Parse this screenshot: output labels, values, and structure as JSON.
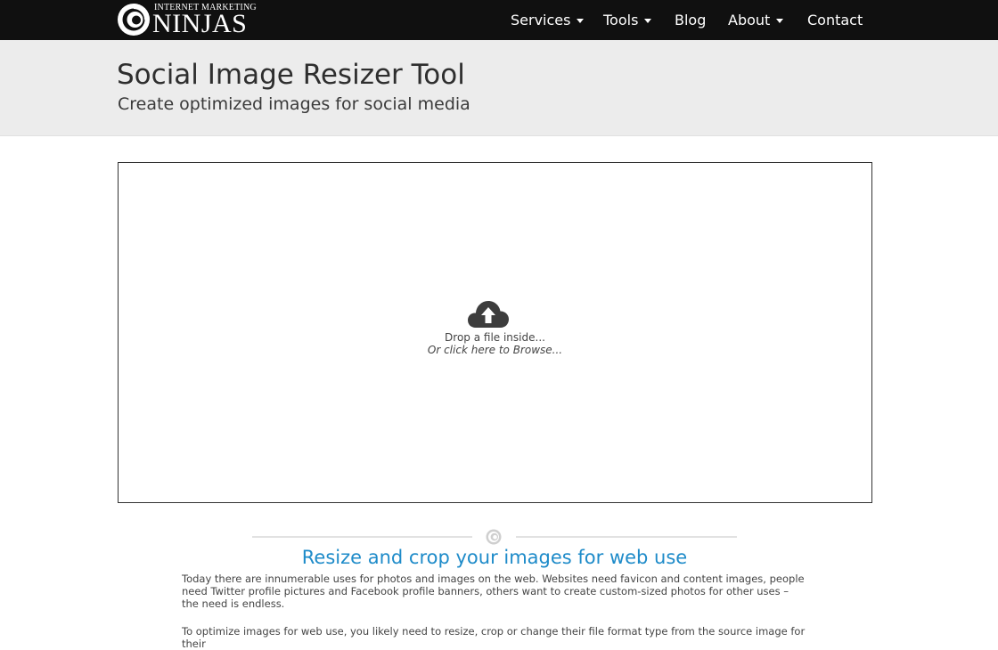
{
  "brand": {
    "small_text": "INTERNET MARKETING",
    "big_text": "NINJAS"
  },
  "nav": {
    "items": [
      {
        "label": "Services",
        "dropdown": true
      },
      {
        "label": "Tools",
        "dropdown": true
      },
      {
        "label": "Blog",
        "dropdown": false
      },
      {
        "label": "About",
        "dropdown": true
      },
      {
        "label": "Contact",
        "dropdown": false
      }
    ]
  },
  "hero": {
    "title": "Social Image Resizer Tool",
    "subtitle": "Create optimized images for social media"
  },
  "dropzone": {
    "icon": "cloud-upload-icon",
    "line1": "Drop a file inside...",
    "line2": "Or click here to Browse..."
  },
  "section": {
    "heading": "Resize and crop your images for web use",
    "paragraphs": [
      "Today there are innumerable uses for photos and images on the web. Websites need favicon and content images, people need Twitter profile pictures and Facebook profile banners, others want to create custom-sized photos for other uses – the need is endless.",
      "To optimize images for web use, you likely need to resize, crop or change their file format type from the source image for their"
    ]
  },
  "colors": {
    "navbar_bg": "#101010",
    "hero_bg": "#ececec",
    "heading_accent": "#1e8bc9"
  }
}
